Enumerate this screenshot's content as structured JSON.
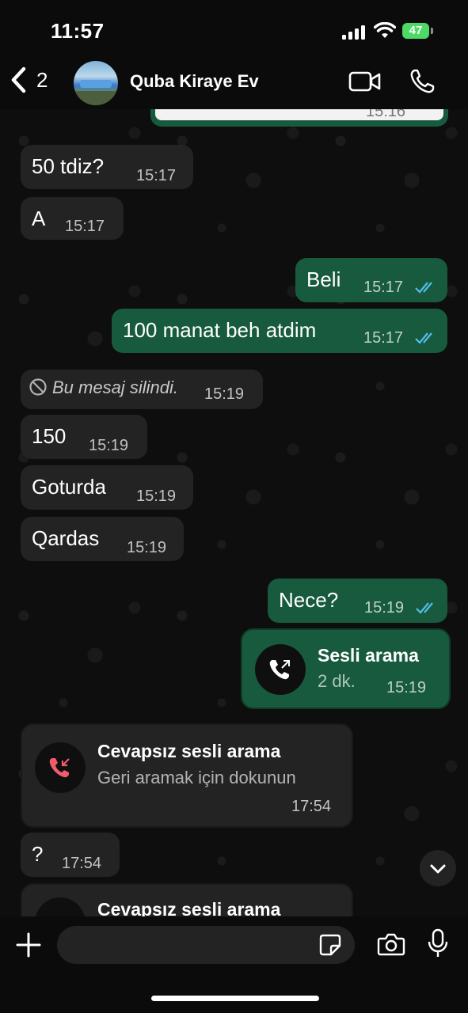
{
  "status_bar": {
    "time": "11:57",
    "battery": "47"
  },
  "header": {
    "back_count": "2",
    "contact_name": "Quba Kiraye Ev"
  },
  "messages": [
    {
      "text": "50 tdiz?",
      "time": "15:17"
    },
    {
      "text": "A",
      "time": "15:17"
    },
    {
      "text": "Beli",
      "time": "15:17"
    },
    {
      "text": "100 manat beh atdim",
      "time": "15:17"
    },
    {
      "text": "Bu mesaj silindi.",
      "time": "15:19"
    },
    {
      "text": "150",
      "time": "15:19"
    },
    {
      "text": "Goturda",
      "time": "15:19"
    },
    {
      "text": "Qardas",
      "time": "15:19"
    },
    {
      "text": "Nece?",
      "time": "15:19"
    },
    {
      "text": "?",
      "time": "17:54"
    }
  ],
  "partial_top": {
    "time": "15:16"
  },
  "outgoing_call": {
    "title": "Sesli arama",
    "duration": "2 dk.",
    "time": "15:19"
  },
  "missed_call": {
    "title": "Cevapsız sesli arama",
    "subtitle": "Geri aramak için dokunun",
    "time": "17:54"
  },
  "missed_call_partial": {
    "title": "Cevapsız sesli arama"
  },
  "colors": {
    "incoming": "#232323",
    "outgoing": "#175a3d",
    "read_ticks": "#53bdeb",
    "missed": "#f15c6d"
  }
}
